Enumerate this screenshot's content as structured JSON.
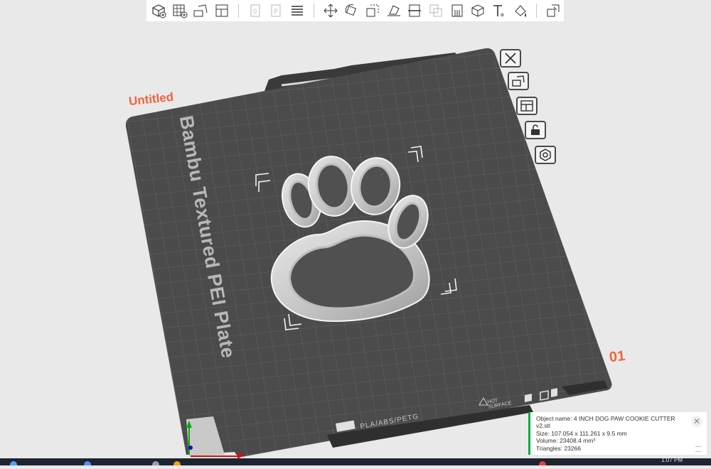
{
  "toolbar": {
    "items": [
      {
        "name": "add-object-icon",
        "disabled": false
      },
      {
        "name": "add-plate-icon",
        "disabled": false
      },
      {
        "name": "auto-orient-icon",
        "disabled": false
      },
      {
        "name": "arrange-icon",
        "disabled": false
      },
      {
        "name": "split-objects-icon",
        "disabled": true
      },
      {
        "name": "split-parts-icon",
        "disabled": true
      },
      {
        "name": "variable-layer-height-icon",
        "disabled": false
      },
      {
        "name": "move-icon",
        "disabled": false
      },
      {
        "name": "rotate-icon",
        "disabled": false
      },
      {
        "name": "scale-icon",
        "disabled": false
      },
      {
        "name": "lay-on-face-icon",
        "disabled": false
      },
      {
        "name": "cut-icon",
        "disabled": false
      },
      {
        "name": "boolean-icon",
        "disabled": true
      },
      {
        "name": "support-painting-icon",
        "disabled": false
      },
      {
        "name": "seam-painting-icon",
        "disabled": false
      },
      {
        "name": "text-icon",
        "disabled": false
      },
      {
        "name": "color-painting-icon",
        "disabled": false
      },
      {
        "name": "assembly-view-icon",
        "disabled": false
      }
    ]
  },
  "plate": {
    "name": "Untitled",
    "number": "01",
    "brand": "Bambu Textured PEI Plate",
    "surface": "PLA/ABS/PETG",
    "hot_line1": "HOT",
    "hot_line2": "SURFACE"
  },
  "plate_tools": [
    {
      "name": "delete-plate-icon"
    },
    {
      "name": "auto-orient-plate-icon"
    },
    {
      "name": "arrange-plate-icon"
    },
    {
      "name": "lock-plate-icon"
    },
    {
      "name": "plate-settings-icon"
    }
  ],
  "object_info": {
    "name_line": "Object name: 4 INCH DOG PAW COOKIE CUTTER v2.stl",
    "size_line": "Size: 107.054 x 111.261 x 9.5 mm",
    "volume_line": "Volume: 23408.4 mm³",
    "triangles_line": "Triangles: 23266"
  },
  "taskbar": {
    "time": "1:07 PM"
  },
  "colors": {
    "accent": "#00ae42",
    "plate_label": "#f0643c",
    "plate_surface": "#4b4b4b"
  }
}
